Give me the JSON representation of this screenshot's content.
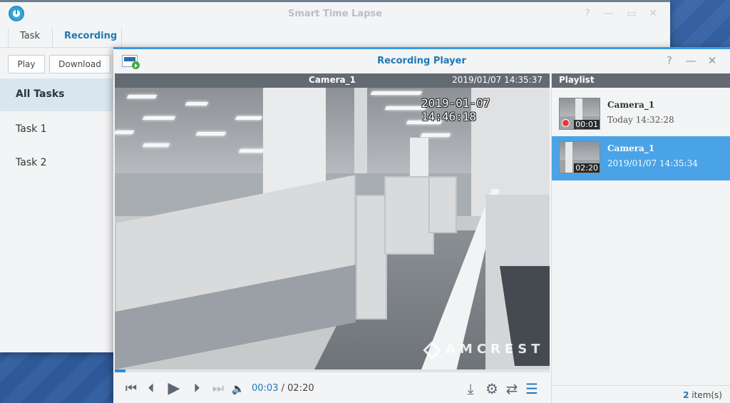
{
  "app": {
    "title": "Smart Time Lapse",
    "help": "?",
    "minimize": "—",
    "maximize": "▭",
    "close": "✕",
    "tabs": [
      "Task",
      "Recording"
    ],
    "active_tab": "Recording",
    "buttons": {
      "play": "Play",
      "download": "Download"
    },
    "sidebar": [
      {
        "label": "All Tasks",
        "active": true
      },
      {
        "label": "Task 1",
        "active": false
      },
      {
        "label": "Task 2",
        "active": false
      }
    ]
  },
  "player": {
    "title": "Recording Player",
    "help": "?",
    "minimize": "—",
    "close": "✕",
    "video": {
      "camera": "Camera_1",
      "timestamp": "2019/01/07 14:35:37",
      "osd_timestamp": "2019-01-07 14:46:18",
      "watermark": "AMCREST",
      "progress": 0.025
    },
    "controls": {
      "first_icon": "⏮",
      "prev_icon": "⏴",
      "play_icon": "▶",
      "next_icon": "⏵",
      "fast_forward_icon": "⏭",
      "volume_icon": "🔈",
      "current_time": "00:03",
      "separator": "/",
      "total_time": "02:20",
      "download_icon": "⤓",
      "settings_icon": "⚙",
      "repeat_icon": "⇄",
      "playlist_icon": "☰"
    },
    "playlist": {
      "header": "Playlist",
      "items": [
        {
          "name": "Camera_1",
          "time": "Today 14:32:28",
          "duration": "00:01",
          "recording": true,
          "selected": false
        },
        {
          "name": "Camera_1",
          "time": "2019/01/07 14:35:34",
          "duration": "02:20",
          "recording": false,
          "selected": true
        }
      ],
      "count": "2",
      "count_label": "item(s)"
    }
  },
  "colors": {
    "accent": "#1f78b4",
    "selected": "#4aa3e6",
    "header_bar": "#636a72",
    "desktop": "#3a6bb0"
  }
}
